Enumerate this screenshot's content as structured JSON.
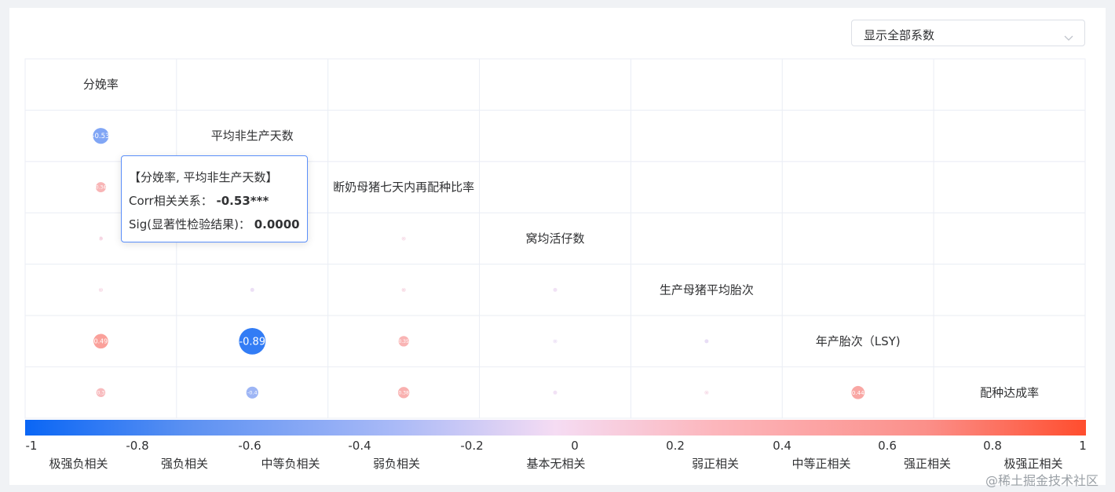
{
  "select": {
    "value": "显示全部系数"
  },
  "chart_data": {
    "type": "heatmap",
    "variables": [
      "分娩率",
      "平均非生产天数",
      "断奶母猪七天内再配种比率",
      "窝均活仔数",
      "生产母猪平均胎次",
      "年产胎次（LSY)",
      "配种达成率"
    ],
    "cells": [
      {
        "row": 1,
        "col": 0,
        "value": -0.53,
        "label": "-0.53"
      },
      {
        "row": 2,
        "col": 0,
        "value": 0.34,
        "label": "0.34"
      },
      {
        "row": 2,
        "col": 1,
        "value": -0.25,
        "label": ""
      },
      {
        "row": 3,
        "col": 0,
        "value": 0.1,
        "label": "0.1"
      },
      {
        "row": 3,
        "col": 1,
        "value": -0.05,
        "label": ""
      },
      {
        "row": 3,
        "col": 2,
        "value": 0.08,
        "label": "0"
      },
      {
        "row": 4,
        "col": 0,
        "value": 0.1,
        "label": "0"
      },
      {
        "row": 4,
        "col": 1,
        "value": -0.04,
        "label": ""
      },
      {
        "row": 4,
        "col": 2,
        "value": 0.12,
        "label": "0"
      },
      {
        "row": 4,
        "col": 3,
        "value": -0.02,
        "label": ""
      },
      {
        "row": 5,
        "col": 0,
        "value": 0.49,
        "label": "0.49"
      },
      {
        "row": 5,
        "col": 1,
        "value": -0.89,
        "label": "-0.89"
      },
      {
        "row": 5,
        "col": 2,
        "value": 0.35,
        "label": "0.35"
      },
      {
        "row": 5,
        "col": 3,
        "value": -0.04,
        "label": "0"
      },
      {
        "row": 5,
        "col": 4,
        "value": -0.06,
        "label": ""
      },
      {
        "row": 6,
        "col": 0,
        "value": 0.3,
        "label": "0.3"
      },
      {
        "row": 6,
        "col": 1,
        "value": -0.4,
        "label": "-0.4"
      },
      {
        "row": 6,
        "col": 2,
        "value": 0.38,
        "label": "0.38"
      },
      {
        "row": 6,
        "col": 3,
        "value": -0.02,
        "label": ""
      },
      {
        "row": 6,
        "col": 4,
        "value": 0.08,
        "label": "0"
      },
      {
        "row": 6,
        "col": 5,
        "value": 0.44,
        "label": "0.44"
      }
    ],
    "scale": {
      "min": -1,
      "max": 1,
      "ticks": [
        "-1",
        "-0.8",
        "-0.6",
        "-0.4",
        "-0.2",
        "0",
        "0.2",
        "0.4",
        "0.6",
        "0.8",
        "1"
      ],
      "categories": [
        "极强负相关",
        "强负相关",
        "中等负相关",
        "弱负相关",
        "基本无相关",
        "弱正相关",
        "中等正相关",
        "强正相关",
        "极强正相关"
      ],
      "colors": {
        "negative": "#1a6ff5",
        "neutral": "#f5e4f5",
        "positive": "#ff5a3c"
      }
    }
  },
  "tooltip": {
    "title": "【分娩率, 平均非生产天数】",
    "corr_label": "Corr相关关系：",
    "corr_value": "-0.53***",
    "sig_label": "Sig(显著性检验结果)：",
    "sig_value": "0.0000"
  },
  "watermark": "@稀土掘金技术社区"
}
